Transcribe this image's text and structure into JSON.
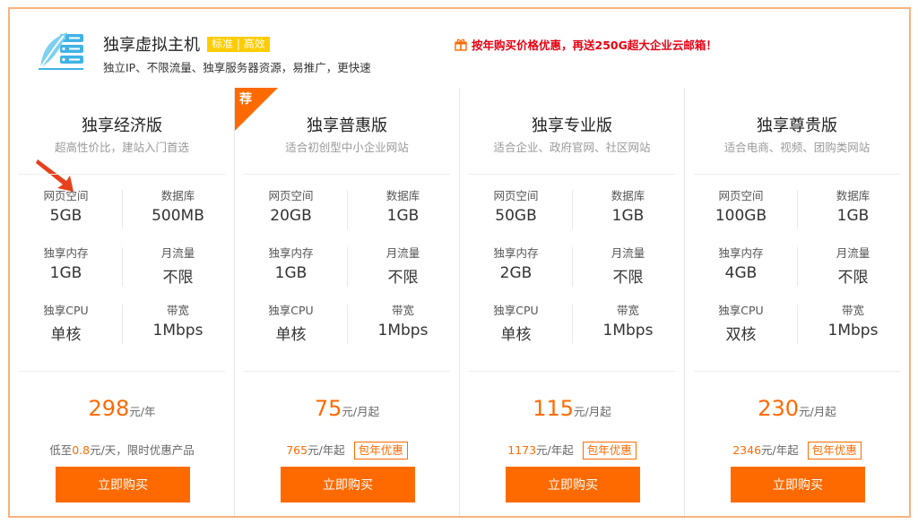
{
  "header": {
    "title": "独享虚拟主机",
    "tag": "标准 | 高效",
    "subtitle": "独立IP、不限流量、独享服务器资源，易推广，更快速",
    "promo": "按年购买价格优惠，再送250G超大企业云邮箱！",
    "logo_icon": "server-leaf-icon",
    "promo_icon": "gift-icon"
  },
  "colors": {
    "accent": "#ff6a00",
    "promo": "#e60012",
    "tag": "#ffcc00",
    "border": "#f7b27e"
  },
  "plans": [
    {
      "name": "独享经济版",
      "desc": "超高性价比，建站入门首选",
      "specs": [
        {
          "label": "网页空间",
          "value": "5GB"
        },
        {
          "label": "数据库",
          "value": "500MB"
        },
        {
          "label": "独享内存",
          "value": "1GB"
        },
        {
          "label": "月流量",
          "value": "不限"
        },
        {
          "label": "独享CPU",
          "value": "单核"
        },
        {
          "label": "带宽",
          "value": "1Mbps"
        }
      ],
      "price": "298",
      "price_unit": "元/年",
      "sub_prefix": "低至",
      "sub_highlight": "0.8",
      "sub_suffix": "元/天，限时优惠产品",
      "buy": "立即购买"
    },
    {
      "name": "独享普惠版",
      "desc": "适合初创型中小企业网站",
      "recommended": "荐",
      "specs": [
        {
          "label": "网页空间",
          "value": "20GB"
        },
        {
          "label": "数据库",
          "value": "1GB"
        },
        {
          "label": "独享内存",
          "value": "1GB"
        },
        {
          "label": "月流量",
          "value": "不限"
        },
        {
          "label": "独享CPU",
          "value": "单核"
        },
        {
          "label": "带宽",
          "value": "1Mbps"
        }
      ],
      "price": "75",
      "price_unit": "元/月起",
      "year_price": "765",
      "year_unit": "元/年起",
      "badge": "包年优惠",
      "buy": "立即购买"
    },
    {
      "name": "独享专业版",
      "desc": "适合企业、政府官网、社区网站",
      "specs": [
        {
          "label": "网页空间",
          "value": "50GB"
        },
        {
          "label": "数据库",
          "value": "1GB"
        },
        {
          "label": "独享内存",
          "value": "2GB"
        },
        {
          "label": "月流量",
          "value": "不限"
        },
        {
          "label": "独享CPU",
          "value": "单核"
        },
        {
          "label": "带宽",
          "value": "1Mbps"
        }
      ],
      "price": "115",
      "price_unit": "元/月起",
      "year_price": "1173",
      "year_unit": "元/年起",
      "badge": "包年优惠",
      "buy": "立即购买"
    },
    {
      "name": "独享尊贵版",
      "desc": "适合电商、视频、团购类网站",
      "specs": [
        {
          "label": "网页空间",
          "value": "100GB"
        },
        {
          "label": "数据库",
          "value": "1GB"
        },
        {
          "label": "独享内存",
          "value": "4GB"
        },
        {
          "label": "月流量",
          "value": "不限"
        },
        {
          "label": "独享CPU",
          "value": "双核"
        },
        {
          "label": "带宽",
          "value": "1Mbps"
        }
      ],
      "price": "230",
      "price_unit": "元/月起",
      "year_price": "2346",
      "year_unit": "元/年起",
      "badge": "包年优惠",
      "buy": "立即购买"
    }
  ]
}
